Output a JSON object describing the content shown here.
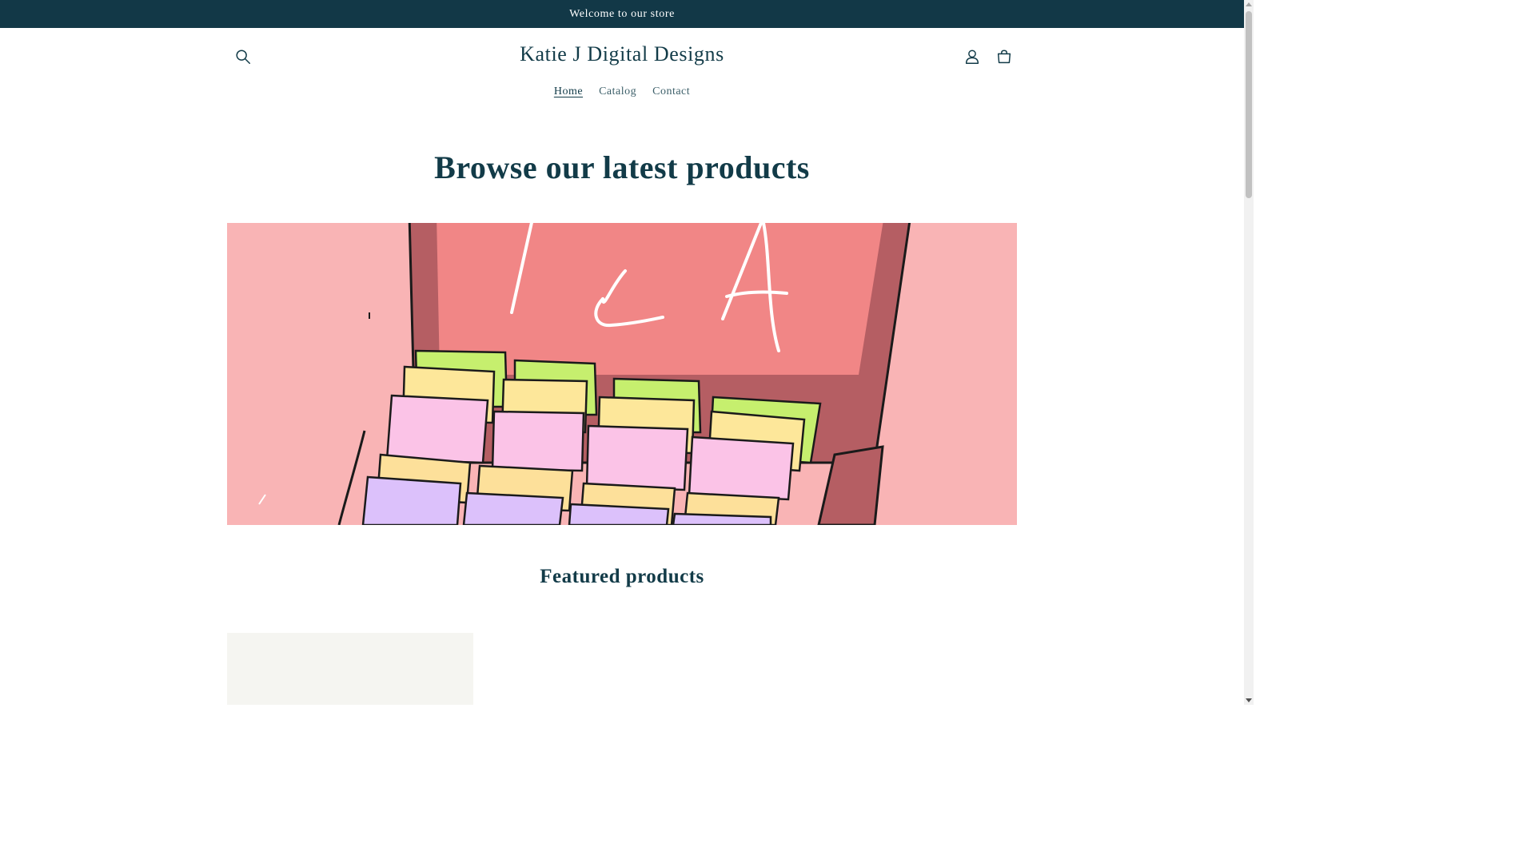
{
  "announcement": {
    "text": "Welcome to our store"
  },
  "header": {
    "logo": "Katie J Digital Designs",
    "icons": {
      "search": "search-icon",
      "account": "account-icon",
      "cart": "cart-icon"
    }
  },
  "nav": [
    {
      "label": "Home",
      "active": true
    },
    {
      "label": "Catalog",
      "active": false
    },
    {
      "label": "Contact",
      "active": false
    }
  ],
  "main": {
    "headline": "Browse our latest products",
    "featured_heading": "Featured products"
  },
  "colors": {
    "announcement_bg": "#123847",
    "text": "#123b48",
    "hero_bg": "#f9b4b5",
    "box_lid": "#f18686",
    "box_body": "#b55e63"
  }
}
